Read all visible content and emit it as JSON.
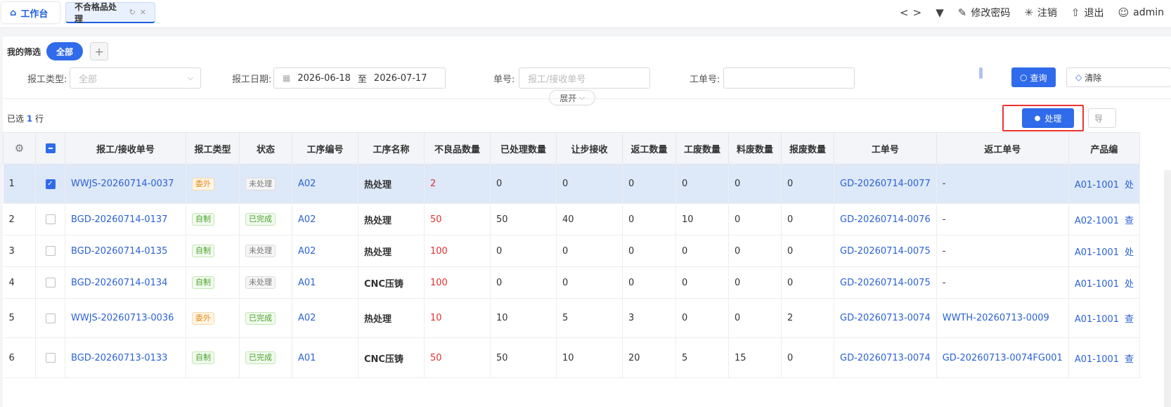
{
  "tabs": {
    "home_label": "工作台",
    "active_label": "不合格品处理"
  },
  "header": {
    "nav_prev": "<",
    "nav_next": ">",
    "dropdown": "▼",
    "change_password": "修改密码",
    "logout_session": "注销",
    "exit": "退出",
    "user": "admin"
  },
  "filter": {
    "my_filters_label": "我的筛选",
    "all_pill": "全部",
    "add": "+"
  },
  "form": {
    "report_type_label": "报工类型:",
    "report_type_placeholder": "全部",
    "report_date_label": "报工日期:",
    "date_from": "2026-06-18",
    "date_sep": "至",
    "date_to": "2026-07-17",
    "doc_no_label": "单号:",
    "doc_no_placeholder": "报工/接收单号",
    "work_order_label": "工单号:",
    "work_order_value": "",
    "query_button": "查询",
    "clear_button": "清除",
    "expand_button": "展开"
  },
  "selection": {
    "prefix": "已选",
    "count": "1",
    "suffix": "行"
  },
  "actions": {
    "handle_button": "处理",
    "export_button": "导"
  },
  "table": {
    "headers": [
      "报工/接收单号",
      "报工类型",
      "状态",
      "工序编号",
      "工序名称",
      "不良品数量",
      "已处理数量",
      "让步接收",
      "返工数量",
      "工废数量",
      "料废数量",
      "报废数量",
      "工单号",
      "返工单号",
      "产品编"
    ],
    "rows": [
      {
        "idx": "1",
        "checked": true,
        "doc": "WWJS-20260714-0037",
        "type": "委外",
        "status": "未处理",
        "op_code": "A02",
        "op_name": "热处理",
        "defect": "2",
        "handled": "0",
        "concession": "0",
        "rework": "0",
        "work_scrap": "0",
        "mat_scrap": "0",
        "scrap": "0",
        "order": "GD-20260714-0077",
        "rework_order": "-",
        "product": "A01-1001",
        "action": "处"
      },
      {
        "idx": "2",
        "checked": false,
        "doc": "BGD-20260714-0137",
        "type": "自制",
        "status": "已完成",
        "op_code": "A02",
        "op_name": "热处理",
        "defect": "50",
        "handled": "50",
        "concession": "40",
        "rework": "0",
        "work_scrap": "10",
        "mat_scrap": "0",
        "scrap": "0",
        "order": "GD-20260714-0076",
        "rework_order": "-",
        "product": "A02-1001",
        "action": "查"
      },
      {
        "idx": "3",
        "checked": false,
        "doc": "BGD-20260714-0135",
        "type": "自制",
        "status": "未处理",
        "op_code": "A02",
        "op_name": "热处理",
        "defect": "100",
        "handled": "0",
        "concession": "0",
        "rework": "0",
        "work_scrap": "0",
        "mat_scrap": "0",
        "scrap": "0",
        "order": "GD-20260714-0075",
        "rework_order": "-",
        "product": "A01-1001",
        "action": "处"
      },
      {
        "idx": "4",
        "checked": false,
        "doc": "BGD-20260714-0134",
        "type": "自制",
        "status": "未处理",
        "op_code": "A01",
        "op_name": "CNC压铸",
        "defect": "100",
        "handled": "0",
        "concession": "0",
        "rework": "0",
        "work_scrap": "0",
        "mat_scrap": "0",
        "scrap": "0",
        "order": "GD-20260714-0075",
        "rework_order": "-",
        "product": "A01-1001",
        "action": "处"
      },
      {
        "idx": "5",
        "checked": false,
        "doc": "WWJS-20260713-0036",
        "type": "委外",
        "status": "已完成",
        "op_code": "A02",
        "op_name": "热处理",
        "defect": "10",
        "handled": "10",
        "concession": "5",
        "rework": "3",
        "work_scrap": "0",
        "mat_scrap": "0",
        "scrap": "2",
        "order": "GD-20260713-0074",
        "rework_order": "WWTH-20260713-0009",
        "product": "A01-1001",
        "action": "查"
      },
      {
        "idx": "6",
        "checked": false,
        "doc": "BGD-20260713-0133",
        "type": "自制",
        "status": "已完成",
        "op_code": "A01",
        "op_name": "CNC压铸",
        "defect": "50",
        "handled": "50",
        "concession": "10",
        "rework": "20",
        "work_scrap": "5",
        "mat_scrap": "15",
        "scrap": "0",
        "order": "GD-20260713-0074",
        "rework_order": "GD-20260713-0074FG001",
        "product": "A01-1001",
        "action": "查"
      }
    ]
  },
  "colors": {
    "primary": "#2f6bea",
    "link": "#2b62d6",
    "danger": "#e43030",
    "highlight": "#e33333"
  }
}
